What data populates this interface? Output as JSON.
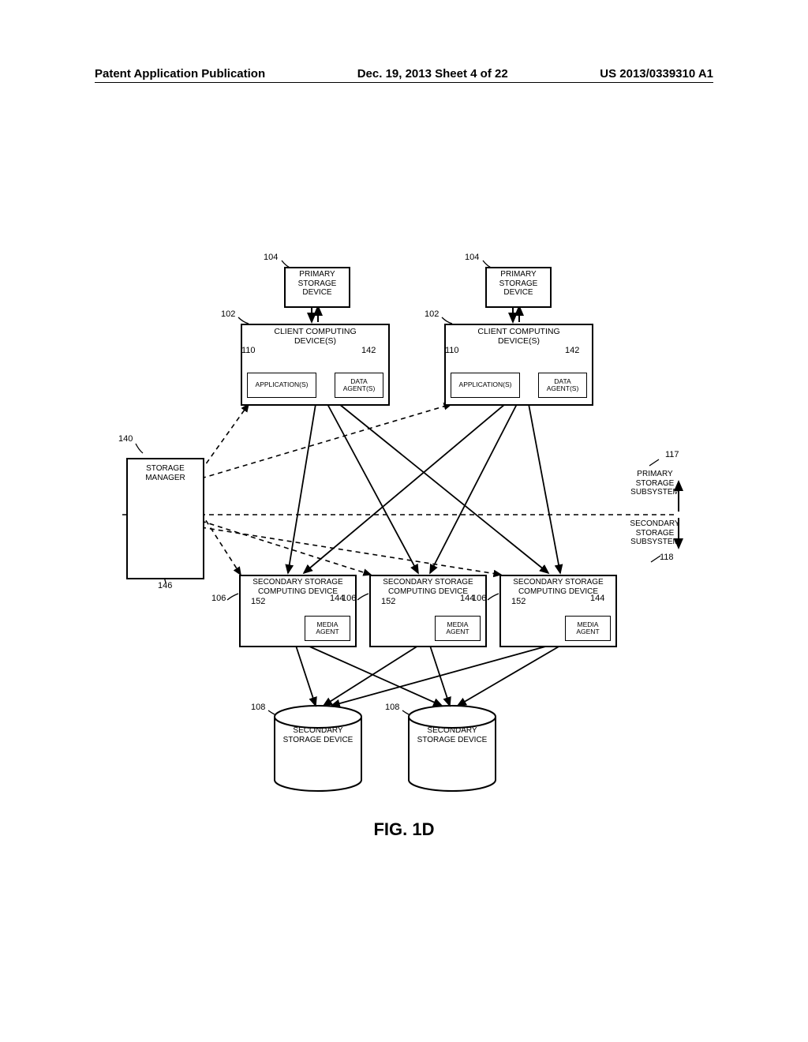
{
  "header": {
    "left": "Patent Application Publication",
    "mid": "Dec. 19, 2013  Sheet 4 of 22",
    "right": "US 2013/0339310 A1"
  },
  "figure_caption": "FIG. 1D",
  "labels": {
    "primary_storage_device": "PRIMARY\nSTORAGE\nDEVICE",
    "client_computing_device": "CLIENT COMPUTING\nDEVICE(S)",
    "applications": "APPLICATION(S)",
    "data_agents": "DATA\nAGENT(S)",
    "storage_manager": "STORAGE\nMANAGER",
    "secondary_storage_computing_device": "SECONDARY STORAGE\nCOMPUTING DEVICE",
    "media_agent": "MEDIA\nAGENT",
    "secondary_storage_device": "SECONDARY\nSTORAGE DEVICE",
    "primary_storage_subsystem": "PRIMARY\nSTORAGE\nSUBSYSTEM",
    "secondary_storage_subsystem": "SECONDARY\nSTORAGE\nSUBSYSTEM"
  },
  "refs": {
    "r104": "104",
    "r102": "102",
    "r110": "110",
    "r142": "142",
    "r140": "140",
    "r117": "117",
    "r118": "118",
    "r146": "146",
    "r106": "106",
    "r152": "152",
    "r144": "144",
    "r108": "108"
  }
}
